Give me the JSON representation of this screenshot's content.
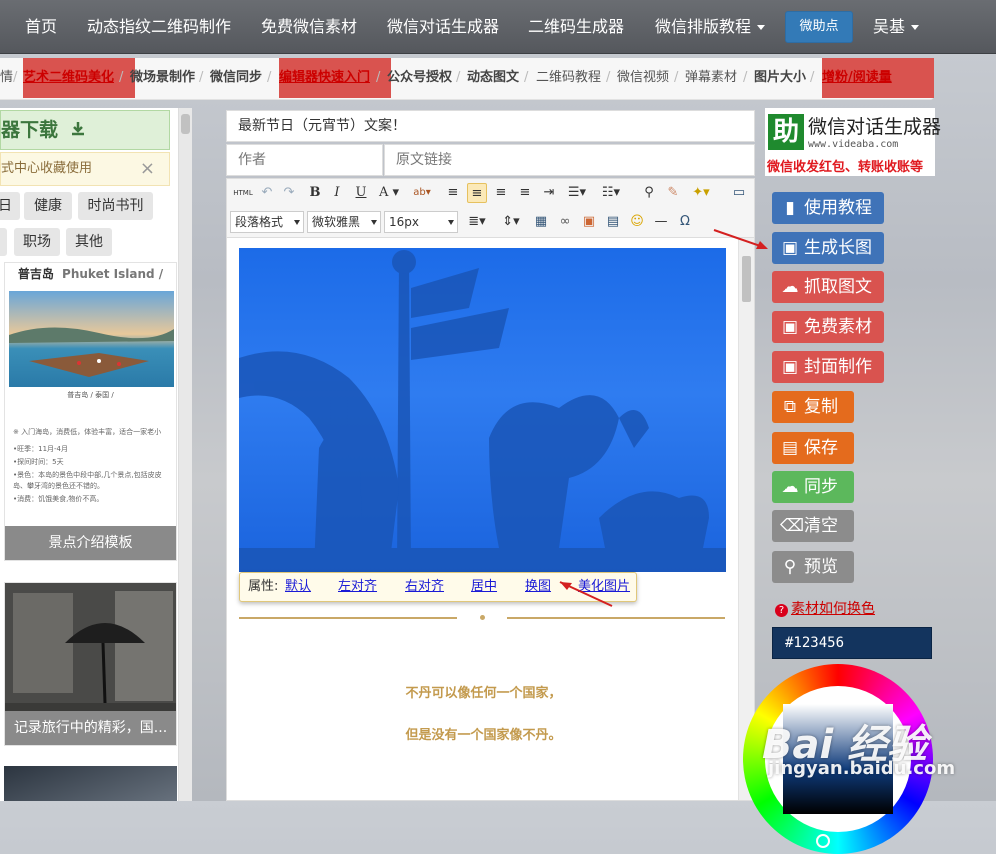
{
  "topnav": {
    "items": [
      "首页",
      "动态指纹二维码制作",
      "免费微信素材",
      "微信对话生成器",
      "二维码生成器",
      "微信排版教程"
    ],
    "assistant_button": "微助点",
    "user_name": "吴基"
  },
  "subbar": {
    "items": [
      "情",
      "艺术二维码美化",
      "微场景制作",
      "微信同步",
      "编辑器快速入门",
      "公众号授权",
      "动态图文",
      "二维码教程",
      "微信视频",
      "弹幕素材",
      "图片大小",
      "增粉/阅读量"
    ]
  },
  "left": {
    "download_banner": "器下载",
    "tip_text": "式中心收藏使用",
    "tip_close": "×",
    "tags": [
      "日",
      "健康",
      "时尚书刊",
      "",
      "职场",
      "其他"
    ],
    "template1": {
      "header": "普吉岛",
      "header_en": "Phuket Island /",
      "location": "普吉岛 / 泰国 /",
      "body_lines": [
        "※ 入门海岛，消费低，体验丰富，适合一家老小",
        "•旺季：11月-4月",
        "•探间时间：5天",
        "•景色：本岛的景色中段中部,几个景点,包括皮皮岛、攀牙湾的景色还不错的。",
        "•消费：饥饿美食,物价不高。"
      ],
      "caption": "景点介绍模板"
    },
    "template2": {
      "caption": "记录旅行中的精彩，国..."
    }
  },
  "editor": {
    "title_value": "最新节日（元宵节）文案！",
    "author_placeholder": "作者",
    "link_placeholder": "原文链接",
    "toolbar": {
      "html_label": "HTML",
      "bold": "B",
      "italic": "I",
      "underline": "U",
      "font_color": "A",
      "paragraph_format": "段落格式",
      "font_family": "微软雅黑",
      "font_size": "16px",
      "omega": "Ω"
    },
    "image_props": {
      "label": "属性:",
      "links": [
        "默认",
        "左对齐",
        "右对齐",
        "居中",
        "换图",
        "美化图片"
      ]
    },
    "poem_lines": [
      "不丹可以像任何一个国家，",
      "但是没有一个国家像不丹。"
    ]
  },
  "right": {
    "logo_char": "助",
    "logo_name": "微信对话生成器",
    "logo_url": "www.videaba.com",
    "logo_slogan": "微信收发红包、转账收账等",
    "buttons": [
      "使用教程",
      "生成长图",
      "抓取图文",
      "免费素材",
      "封面制作",
      "复制",
      "保存",
      "同步",
      "清空",
      "预览"
    ],
    "color_help": "素材如何换色",
    "color_value": "#123456"
  },
  "watermark": {
    "main": "Bai 经验",
    "sub": "jingyan.baidu.com"
  },
  "colors": {
    "accent_blue": "#3f73b8",
    "danger_red": "#d9534f",
    "orange": "#e46b1d",
    "green": "#5cb85c",
    "photo_blue": "#1c6be8",
    "poem_gold": "#c39a4d"
  }
}
